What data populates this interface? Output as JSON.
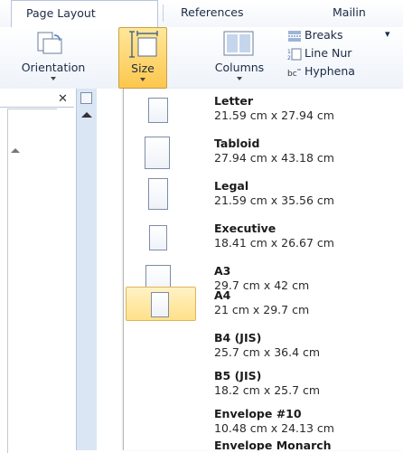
{
  "ribbon_tabs": {
    "page_layout": "Page Layout",
    "references": "References",
    "mailings": "Mailin"
  },
  "ribbon": {
    "orientation": "Orientation",
    "size": "Size",
    "columns": "Columns",
    "breaks": "Breaks",
    "line_numbers": "Line Nur",
    "hyphenation": "Hyphena"
  },
  "menu_items": [
    {
      "name": "Letter",
      "dims": "21.59 cm x 27.94 cm"
    },
    {
      "name": "Tabloid",
      "dims": "27.94 cm x 43.18 cm"
    },
    {
      "name": "Legal",
      "dims": "21.59 cm x 35.56 cm"
    },
    {
      "name": "Executive",
      "dims": "18.41 cm x 26.67 cm"
    },
    {
      "name": "A3",
      "dims": "29.7 cm x 42 cm"
    },
    {
      "name": "A4",
      "dims": "21 cm x 29.7 cm",
      "selected": true
    },
    {
      "name": "B4 (JIS)",
      "dims": "25.7 cm x 36.4 cm"
    },
    {
      "name": "B5 (JIS)",
      "dims": "18.2 cm x 25.7 cm"
    },
    {
      "name": "Envelope #10",
      "dims": "10.48 cm x 24.13 cm"
    },
    {
      "name": "Envelope Monarch",
      "dims": ""
    }
  ],
  "colors": {
    "selection_fill": "#ffe08a",
    "selection_border": "#e3b35a",
    "ribbon_border": "#b6c6dd"
  }
}
